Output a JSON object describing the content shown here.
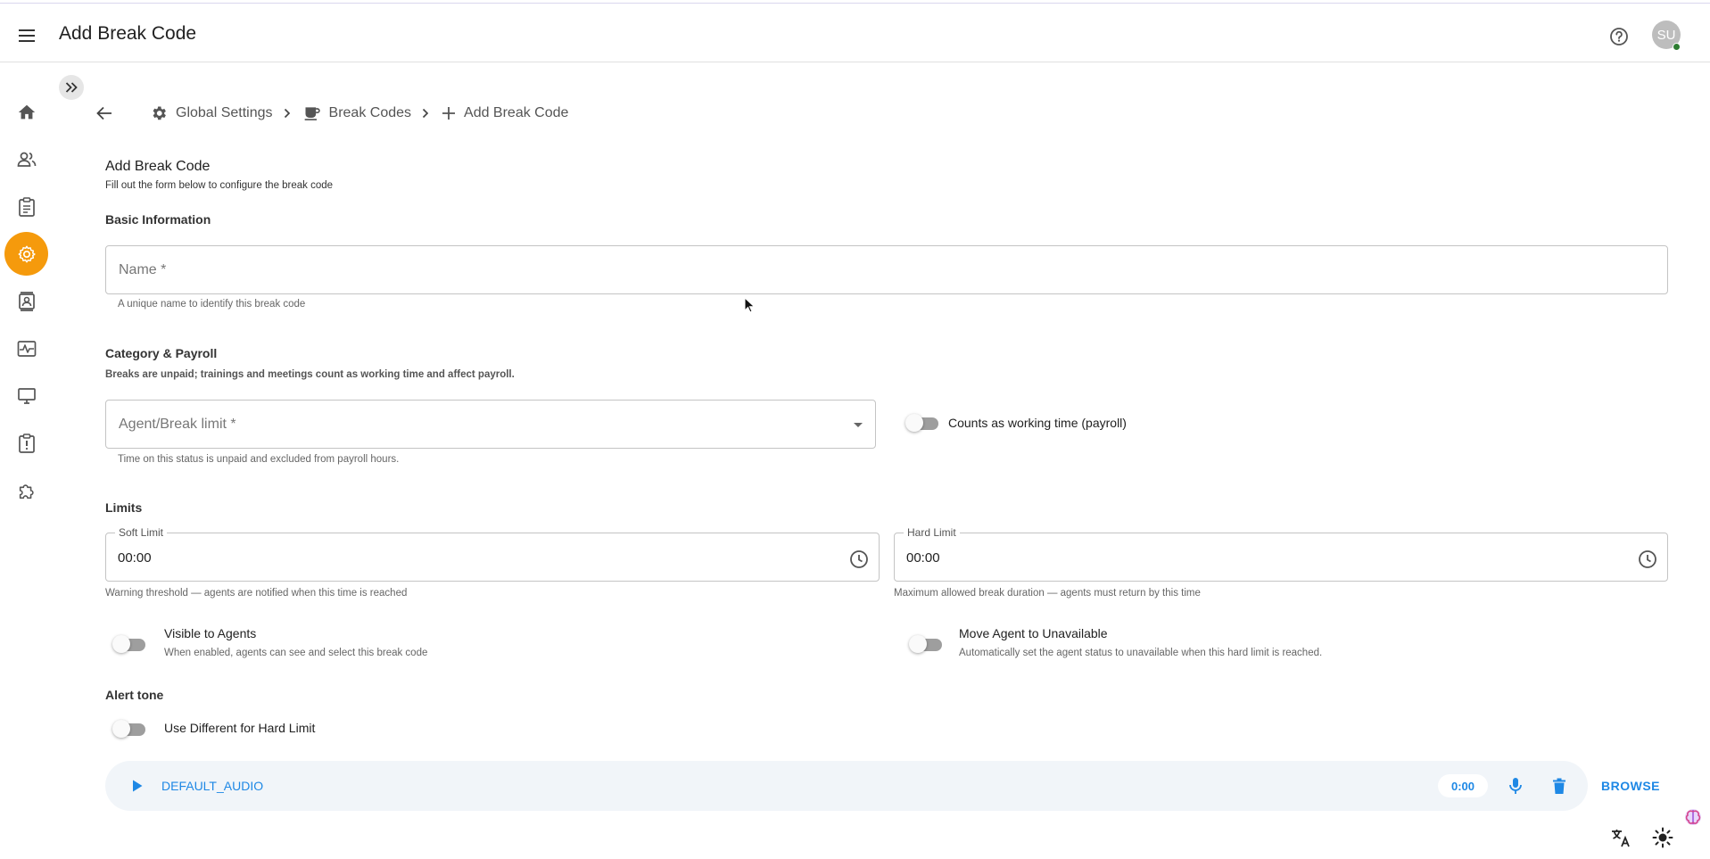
{
  "header": {
    "title": "Add Break Code",
    "avatar_initials": "SU"
  },
  "sidebar": {
    "items": [
      {
        "name": "home",
        "icon": "home-icon"
      },
      {
        "name": "users",
        "icon": "people-icon"
      },
      {
        "name": "reports",
        "icon": "clipboard-icon"
      },
      {
        "name": "settings",
        "icon": "gear-icon",
        "active": true
      },
      {
        "name": "contacts",
        "icon": "contact-book-icon"
      },
      {
        "name": "monitoring",
        "icon": "pulse-icon"
      },
      {
        "name": "screens",
        "icon": "monitor-icon"
      },
      {
        "name": "alerts",
        "icon": "clipboard-alert-icon"
      },
      {
        "name": "plugins",
        "icon": "puzzle-icon"
      }
    ]
  },
  "breadcrumb": {
    "items": [
      {
        "label": "Global Settings",
        "icon": "gear-icon"
      },
      {
        "label": "Break Codes",
        "icon": "coffee-icon"
      },
      {
        "label": "Add Break Code",
        "icon": "plus-icon"
      }
    ]
  },
  "form": {
    "title": "Add Break Code",
    "subtitle": "Fill out the form below to configure the break code",
    "basic": {
      "heading": "Basic Information",
      "name_placeholder": "Name *",
      "name_helper": "A unique name to identify this break code"
    },
    "category": {
      "heading": "Category & Payroll",
      "note": "Breaks are unpaid; trainings and meetings count as working time and affect payroll.",
      "select_placeholder": "Agent/Break limit *",
      "select_helper": "Time on this status is unpaid and excluded from payroll hours.",
      "working_time_label": "Counts as working time (payroll)",
      "working_time_on": false
    },
    "limits": {
      "heading": "Limits",
      "soft_label": "Soft Limit",
      "soft_value": "00:00",
      "soft_helper": "Warning threshold — agents are notified when this time is reached",
      "hard_label": "Hard Limit",
      "hard_value": "00:00",
      "hard_helper": "Maximum allowed break duration — agents must return by this time",
      "visible_label": "Visible to Agents",
      "visible_desc": "When enabled, agents can see and select this break code",
      "visible_on": false,
      "unavailable_label": "Move Agent to Unavailable",
      "unavailable_desc": "Automatically set the agent status to unavailable when this hard limit is reached.",
      "unavailable_on": false
    },
    "alert": {
      "heading": "Alert tone",
      "different_label": "Use Different for Hard Limit",
      "different_on": false,
      "audio_name": "DEFAULT_AUDIO",
      "audio_time": "0:00",
      "browse_label": "BROWSE"
    }
  },
  "colors": {
    "accent": "#f59a0c",
    "link": "#1e88e5",
    "online": "#2e7d32"
  }
}
